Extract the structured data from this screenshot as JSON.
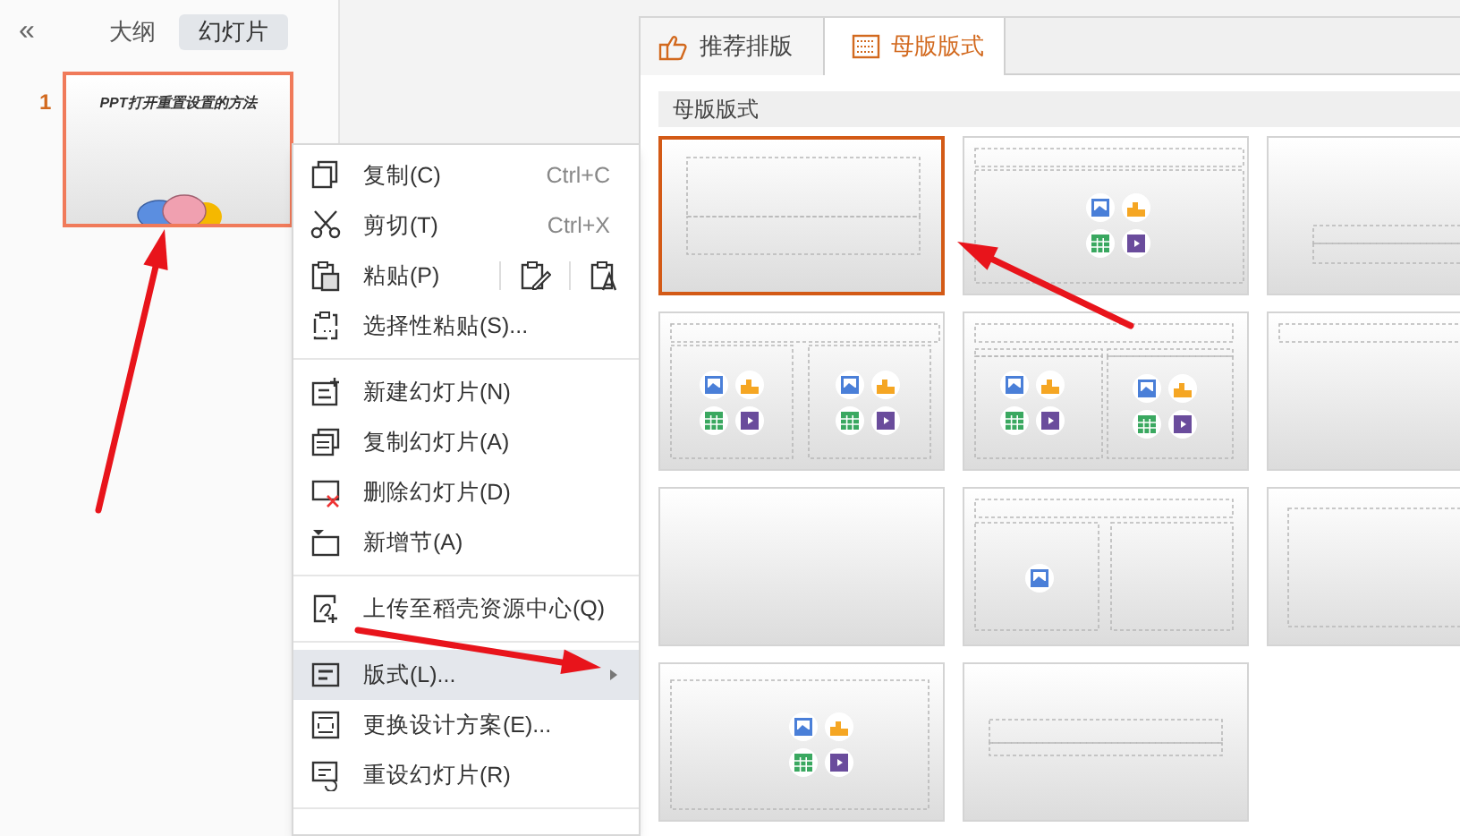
{
  "side_panel": {
    "collapse": "«",
    "tabs": [
      {
        "label": "大纲",
        "selected": false
      },
      {
        "label": "幻灯片",
        "selected": true
      }
    ],
    "slides": [
      {
        "number": "1",
        "title": "PPT打开重置设置的方法",
        "selected": true
      }
    ]
  },
  "context_menu": {
    "items": [
      {
        "kind": "item",
        "label": "复制(C)",
        "shortcut": "Ctrl+C",
        "selected": false,
        "submenu": false
      },
      {
        "kind": "item",
        "label": "剪切(T)",
        "shortcut": "Ctrl+X",
        "selected": false,
        "submenu": false
      },
      {
        "kind": "paste",
        "label": "粘贴(P)",
        "selected": false,
        "submenu": false
      },
      {
        "kind": "item",
        "label": "选择性粘贴(S)...",
        "selected": false,
        "submenu": false
      },
      {
        "kind": "separator"
      },
      {
        "kind": "item",
        "label": "新建幻灯片(N)",
        "selected": false,
        "submenu": false
      },
      {
        "kind": "item",
        "label": "复制幻灯片(A)",
        "selected": false,
        "submenu": false
      },
      {
        "kind": "item",
        "label": "删除幻灯片(D)",
        "selected": false,
        "submenu": false
      },
      {
        "kind": "item",
        "label": "新增节(A)",
        "selected": false,
        "submenu": false
      },
      {
        "kind": "separator"
      },
      {
        "kind": "item",
        "label": "上传至稻壳资源中心(Q)",
        "selected": false,
        "submenu": false
      },
      {
        "kind": "separator"
      },
      {
        "kind": "item",
        "label": "版式(L)...",
        "selected": true,
        "submenu": true
      },
      {
        "kind": "item",
        "label": "更换设计方案(E)...",
        "selected": false,
        "submenu": false
      },
      {
        "kind": "item",
        "label": "重设幻灯片(R)",
        "selected": false,
        "submenu": false
      },
      {
        "kind": "separator"
      }
    ]
  },
  "layout_panel": {
    "tabs": [
      {
        "label": "推荐排版",
        "selected": false
      },
      {
        "label": "母版版式",
        "selected": true
      }
    ],
    "section_title": "母版版式",
    "layouts": [
      {
        "kind": "title",
        "selected": true
      },
      {
        "kind": "title-content",
        "selected": false
      },
      {
        "kind": "section-header",
        "selected": false
      },
      {
        "kind": "two-content",
        "selected": false
      },
      {
        "kind": "comparison",
        "selected": false
      },
      {
        "kind": "title-only",
        "selected": false
      },
      {
        "kind": "blank",
        "selected": false
      },
      {
        "kind": "picture-caption",
        "selected": false
      },
      {
        "kind": "content-only",
        "selected": false
      },
      {
        "kind": "content",
        "selected": false
      },
      {
        "kind": "caption",
        "selected": false
      }
    ]
  }
}
